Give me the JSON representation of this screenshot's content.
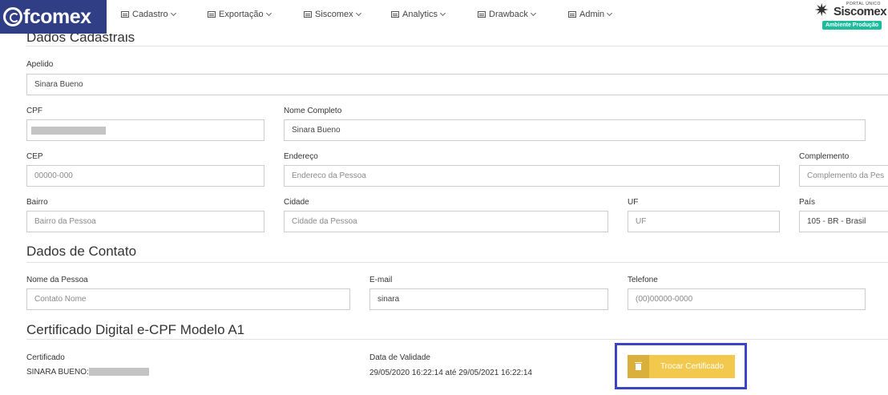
{
  "header": {
    "logo_text": "fcomex",
    "menu": [
      {
        "label": "Cadastro"
      },
      {
        "label": "Exportação"
      },
      {
        "label": "Siscomex"
      },
      {
        "label": "Analytics"
      },
      {
        "label": "Drawback"
      },
      {
        "label": "Admin"
      }
    ],
    "siscomex": {
      "portal": "PORTAL ÚNICO",
      "brand": "Siscomex",
      "environment": "Ambiente Produção"
    }
  },
  "dados_cadastrais": {
    "title": "Dados Cadastrais",
    "apelido": {
      "label": "Apelido",
      "value": "Sinara Bueno"
    },
    "cpf": {
      "label": "CPF",
      "value": ""
    },
    "nome_completo": {
      "label": "Nome Completo",
      "value": "Sinara Bueno"
    },
    "cep": {
      "label": "CEP",
      "placeholder": "00000-000"
    },
    "endereco": {
      "label": "Endereço",
      "placeholder": "Endereco da Pessoa"
    },
    "complemento": {
      "label": "Complemento",
      "placeholder": "Complemento da Pes"
    },
    "bairro": {
      "label": "Bairro",
      "placeholder": "Bairro da Pessoa"
    },
    "cidade": {
      "label": "Cidade",
      "placeholder": "Cidade da Pessoa"
    },
    "uf": {
      "label": "UF",
      "placeholder": "UF"
    },
    "pais": {
      "label": "País",
      "value": "105 - BR - Brasil"
    }
  },
  "dados_contato": {
    "title": "Dados de Contato",
    "nome_pessoa": {
      "label": "Nome da Pessoa",
      "placeholder": "Contato Nome"
    },
    "email": {
      "label": "E-mail",
      "value": "sinara"
    },
    "telefone": {
      "label": "Telefone",
      "placeholder": "(00)00000-0000"
    }
  },
  "certificado": {
    "title": "Certificado Digital e-CPF Modelo A1",
    "cert_label": "Certificado",
    "cert_value": "SINARA BUENO:",
    "validade_label": "Data de Validade",
    "validade_value": "29/05/2020 16:22:14 até 29/05/2021 16:22:14",
    "button_label": "Trocar Certificado"
  }
}
